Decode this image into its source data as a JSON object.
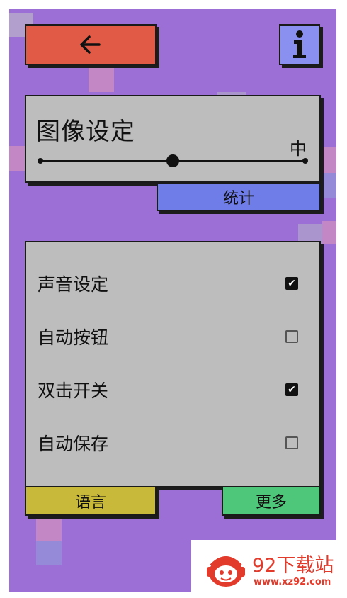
{
  "header": {
    "back_icon": "arrow-left-icon",
    "info_icon": "info-icon"
  },
  "image_settings": {
    "title": "图像设定",
    "level_label": "中",
    "slider_value": 0.5,
    "stats_tab": "统计"
  },
  "settings": {
    "items": [
      {
        "label": "声音设定",
        "checked": true
      },
      {
        "label": "自动按钮",
        "checked": false
      },
      {
        "label": "双击开关",
        "checked": true
      },
      {
        "label": "自动保存",
        "checked": false
      }
    ]
  },
  "footer": {
    "language_tab": "语言",
    "more_tab": "更多"
  },
  "watermark": {
    "name": "92下载站",
    "url": "www.xz92.com"
  },
  "colors": {
    "background": "#9b6fd6",
    "back_button": "#e05a45",
    "info_button": "#8a90f0",
    "panel": "#bdbdbd",
    "stats_tab": "#6f7de8",
    "language_tab": "#c9b93a",
    "more_tab": "#4fc77a",
    "watermark": "#e23a2b"
  }
}
